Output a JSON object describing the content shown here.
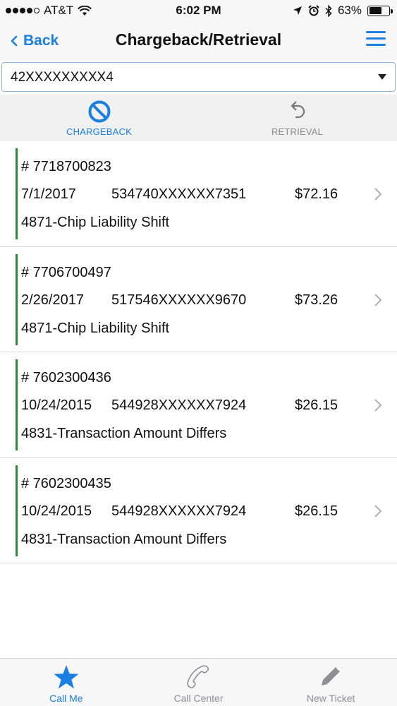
{
  "status_bar": {
    "carrier": "AT&T",
    "time": "6:02 PM",
    "battery": "63%",
    "battery_level": 0.63
  },
  "nav": {
    "back_label": "Back",
    "title": "Chargeback/Retrieval"
  },
  "account_select": {
    "value": "42XXXXXXXXX4"
  },
  "tabs": [
    {
      "label": "CHARGEBACK",
      "icon": "no-symbol-icon",
      "active": true
    },
    {
      "label": "RETRIEVAL",
      "icon": "undo-arrow-icon",
      "active": false
    }
  ],
  "items": [
    {
      "case": "# 7718700823",
      "date": "7/1/2017",
      "card": "534740XXXXXX7351",
      "amount": "$72.16",
      "reason": "4871-Chip Liability Shift"
    },
    {
      "case": "# 7706700497",
      "date": "2/26/2017",
      "card": "517546XXXXXX9670",
      "amount": "$73.26",
      "reason": "4871-Chip Liability Shift"
    },
    {
      "case": "# 7602300436",
      "date": "10/24/2015",
      "card": "544928XXXXXX7924",
      "amount": "$26.15",
      "reason": "4831-Transaction Amount Differs"
    },
    {
      "case": "# 7602300435",
      "date": "10/24/2015",
      "card": "544928XXXXXX7924",
      "amount": "$26.15",
      "reason": "4831-Transaction Amount Differs"
    }
  ],
  "tab_bar": [
    {
      "label": "Call Me",
      "icon": "star-icon",
      "active": true
    },
    {
      "label": "Call Center",
      "icon": "phone-handset-icon",
      "active": false
    },
    {
      "label": "New Ticket",
      "icon": "pencil-icon",
      "active": false
    }
  ],
  "colors": {
    "accent": "#1a7fe0",
    "row_marker": "#2e8b3e"
  }
}
